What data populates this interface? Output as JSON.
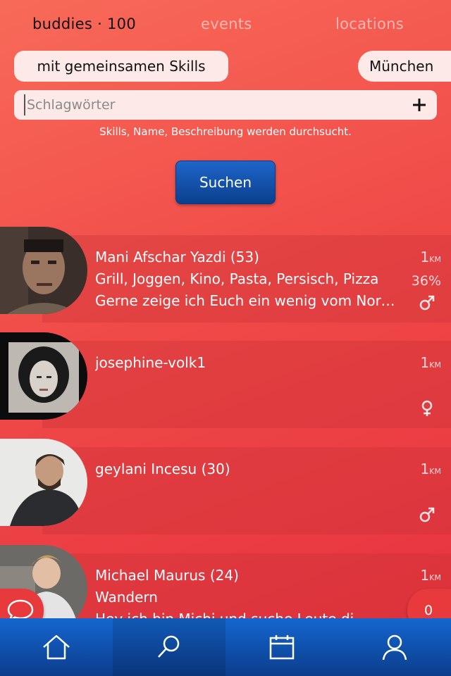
{
  "tabs": {
    "buddies": "buddies · 100",
    "events": "events",
    "locations": "locations"
  },
  "filters": {
    "skills_label": "mit gemeinsamen Skills",
    "city_label": "München"
  },
  "search": {
    "placeholder": "Schlagwörter",
    "value": "",
    "hint": "Skills, Name, Beschreibung werden durchsucht.",
    "button_label": "Suchen"
  },
  "buddies": [
    {
      "name": "Mani Afschar Yazdi (53)",
      "skills": "Grill, Joggen, Kino, Pasta, Persisch, Pizza",
      "description": "Gerne zeige ich Euch ein wenig vom Norden",
      "distance": "1",
      "distance_unit": "KM",
      "match": "36%",
      "gender": "male",
      "gender_symbol": "♂"
    },
    {
      "name": "josephine-volk1",
      "skills": "",
      "description": "",
      "distance": "1",
      "distance_unit": "KM",
      "match": "",
      "gender": "female",
      "gender_symbol": "♀"
    },
    {
      "name": "geylani Incesu (30)",
      "skills": "",
      "description": "",
      "distance": "1",
      "distance_unit": "KM",
      "match": "",
      "gender": "male",
      "gender_symbol": "♂"
    },
    {
      "name": "Michael Maurus (24)",
      "skills": "Wandern",
      "description": "Hey ich bin Michi und suche Leute di",
      "distance": "1",
      "distance_unit": "KM",
      "match": "",
      "gender": "male",
      "gender_symbol": "♂"
    }
  ],
  "fab": {
    "count": "0"
  },
  "nav": {
    "items": [
      "home-icon",
      "search-icon",
      "calendar-icon",
      "profile-icon"
    ]
  },
  "colors": {
    "nav_blue": "#1566d0",
    "accent_red": "#e83a3c",
    "pill_bg": "#fde9e7"
  }
}
